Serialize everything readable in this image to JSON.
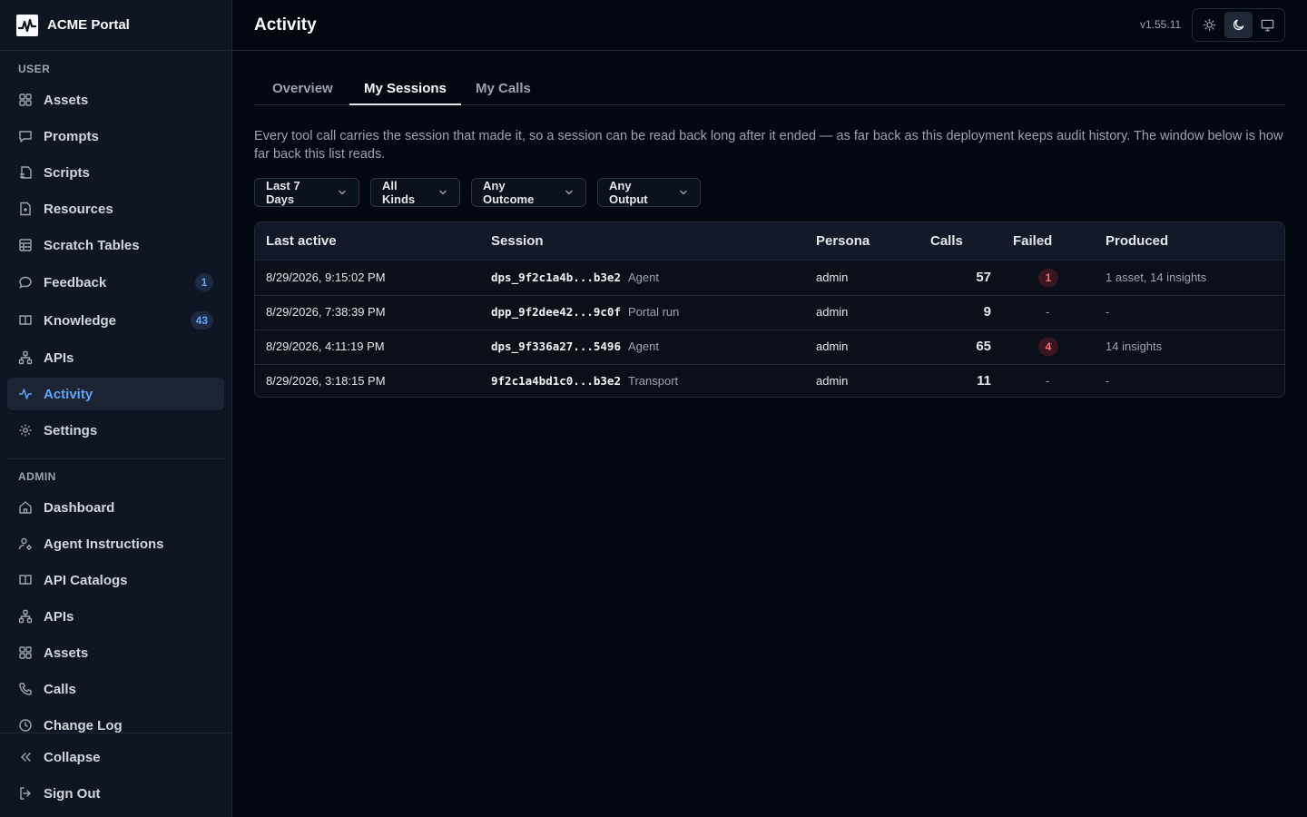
{
  "brand": {
    "name": "ACME Portal"
  },
  "sidebar": {
    "user_label": "USER",
    "user_items": [
      {
        "label": "Assets",
        "icon": "grid-icon"
      },
      {
        "label": "Prompts",
        "icon": "chat-icon"
      },
      {
        "label": "Scripts",
        "icon": "script-icon"
      },
      {
        "label": "Resources",
        "icon": "file-icon"
      },
      {
        "label": "Scratch Tables",
        "icon": "table-icon"
      },
      {
        "label": "Feedback",
        "icon": "message-icon",
        "badge": "1"
      },
      {
        "label": "Knowledge",
        "icon": "book-icon",
        "badge": "43"
      },
      {
        "label": "APIs",
        "icon": "network-icon"
      },
      {
        "label": "Activity",
        "icon": "activity-icon",
        "active": true
      },
      {
        "label": "Settings",
        "icon": "gear-icon"
      }
    ],
    "admin_label": "ADMIN",
    "admin_items": [
      {
        "label": "Dashboard",
        "icon": "home-icon"
      },
      {
        "label": "Agent Instructions",
        "icon": "user-cog-icon"
      },
      {
        "label": "API Catalogs",
        "icon": "book-icon"
      },
      {
        "label": "APIs",
        "icon": "network-icon"
      },
      {
        "label": "Assets",
        "icon": "grid-icon"
      },
      {
        "label": "Calls",
        "icon": "phone-icon"
      },
      {
        "label": "Change Log",
        "icon": "clock-icon"
      }
    ],
    "collapse_label": "Collapse",
    "signout_label": "Sign Out"
  },
  "header": {
    "title": "Activity",
    "version": "v1.55.11"
  },
  "tabs": [
    {
      "label": "Overview"
    },
    {
      "label": "My Sessions",
      "active": true
    },
    {
      "label": "My Calls"
    }
  ],
  "intro": "Every tool call carries the session that made it, so a session can be read back long after it ended — as far back as this deployment keeps audit history. The window below is how far back this list reads.",
  "filters": [
    {
      "label": "Last 7 Days"
    },
    {
      "label": "All Kinds"
    },
    {
      "label": "Any Outcome"
    },
    {
      "label": "Any Output"
    }
  ],
  "table": {
    "columns": [
      "Last active",
      "Session",
      "Persona",
      "Calls",
      "Failed",
      "Produced"
    ],
    "rows": [
      {
        "last_active": "8/29/2026, 9:15:02 PM",
        "session_id": "dps_9f2c1a4b...b3e2",
        "kind": "Agent",
        "persona": "admin",
        "calls": "57",
        "failed": "1",
        "produced": "1 asset, 14 insights"
      },
      {
        "last_active": "8/29/2026, 7:38:39 PM",
        "session_id": "dpp_9f2dee42...9c0f",
        "kind": "Portal run",
        "persona": "admin",
        "calls": "9",
        "failed": "-",
        "produced": "-"
      },
      {
        "last_active": "8/29/2026, 4:11:19 PM",
        "session_id": "dps_9f336a27...5496",
        "kind": "Agent",
        "persona": "admin",
        "calls": "65",
        "failed": "4",
        "produced": "14 insights"
      },
      {
        "last_active": "8/29/2026, 3:18:15 PM",
        "session_id": "9f2c1a4bd1c0...b3e2",
        "kind": "Transport",
        "persona": "admin",
        "calls": "11",
        "failed": "-",
        "produced": "-"
      }
    ]
  },
  "colors": {
    "accent": "#60a5fa",
    "danger": "#f87171",
    "background": "#030712",
    "sidebar": "#0f1623"
  }
}
